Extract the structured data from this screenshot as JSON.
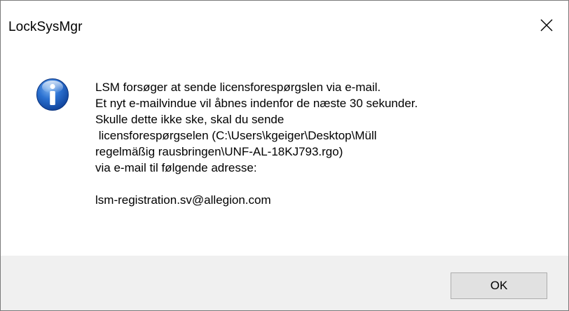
{
  "window": {
    "title": "LockSysMgr",
    "close_icon": "close-icon"
  },
  "dialog": {
    "icon": "information-icon",
    "message_lines": [
      "LSM forsøger at sende licensforespørgslen via e-mail.",
      "Et nyt e-mailvindue vil åbnes indenfor de næste 30 sekunder.",
      "Skulle dette ikke ske, skal du sende",
      " licensforespørgselen (C:\\Users\\kgeiger\\Desktop\\Müll",
      "regelmäßig rausbringen\\UNF-AL-18KJ793.rgo)",
      "via e-mail til følgende adresse:"
    ],
    "email": "lsm-registration.sv@allegion.com"
  },
  "buttons": {
    "ok_label": "OK"
  },
  "colors": {
    "footer_bg": "#f0f0f0",
    "button_bg": "#e1e1e1",
    "button_border": "#adadad",
    "icon_blue": "#1d5fbf"
  }
}
